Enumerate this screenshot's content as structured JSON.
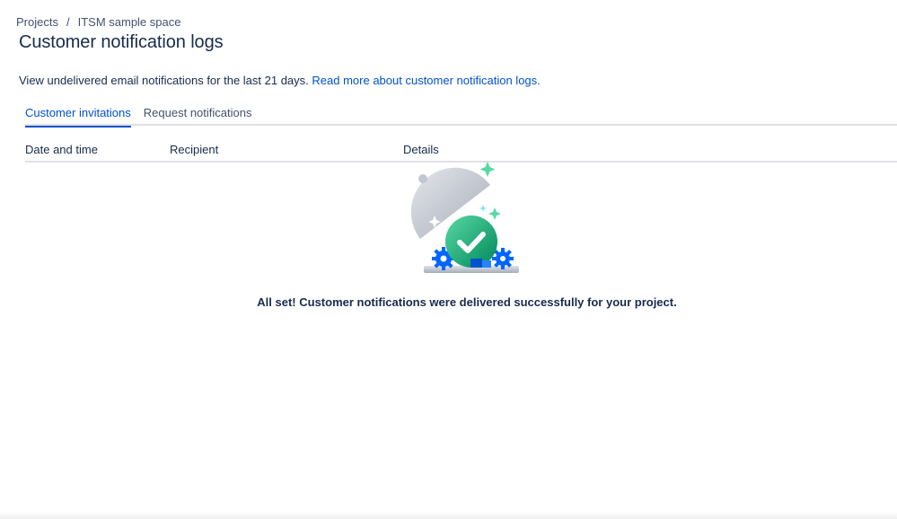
{
  "breadcrumb": {
    "items": [
      "Projects",
      "ITSM sample space"
    ],
    "separator": "/"
  },
  "page": {
    "title": "Customer notification logs",
    "description": "View undelivered email notifications for the last 21 days.",
    "read_more_link": "Read more about customer notification logs."
  },
  "tabs": [
    {
      "label": "Customer invitations",
      "active": true
    },
    {
      "label": "Request notifications",
      "active": false
    }
  ],
  "table": {
    "columns": [
      "Date and time",
      "Recipient",
      "Details"
    ]
  },
  "empty_state": {
    "illustration": "cloche-checkmark-illustration",
    "message": "All set! Customer notifications were delivered successfully for your project."
  },
  "colors": {
    "link": "#0052cc",
    "text": "#172b4d",
    "subtle_text": "#42526e",
    "divider": "#dfe1e6",
    "success_green": "#36b37e"
  }
}
